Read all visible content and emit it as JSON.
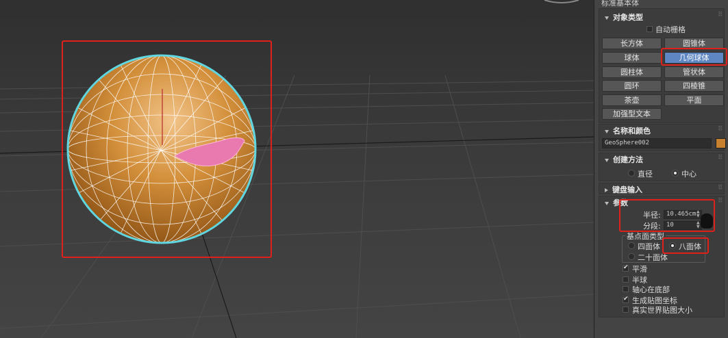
{
  "panel": {
    "top_label": "标准基本体",
    "object_type": {
      "header": "对象类型",
      "auto_grid": "自动栅格",
      "auto_grid_checked": false,
      "buttons": [
        "长方体",
        "圆锥体",
        "球体",
        "几何球体",
        "圆柱体",
        "管状体",
        "圆环",
        "四棱锥",
        "茶壶",
        "平面",
        "加强型文本"
      ],
      "selected": "几何球体"
    },
    "name_color": {
      "header": "名称和颜色",
      "name": "GeoSphere002",
      "color": "#c8812f"
    },
    "creation_method": {
      "header": "创建方法",
      "options": [
        "直径",
        "中心"
      ],
      "selected": "中心"
    },
    "keyboard_entry": {
      "header": "键盘输入"
    },
    "parameters": {
      "header": "参数",
      "radius_label": "半径:",
      "radius_value": "10.465cm",
      "segments_label": "分段:",
      "segments_value": "10",
      "base_type_label": "基点面类型",
      "base_types": [
        "四面体",
        "八面体",
        "二十面体"
      ],
      "base_type_selected": "八面体",
      "checkboxes": [
        {
          "label": "平滑",
          "checked": true
        },
        {
          "label": "半球",
          "checked": false
        },
        {
          "label": "轴心在底部",
          "checked": false
        },
        {
          "label": "生成贴图坐标",
          "checked": true
        },
        {
          "label": "真实世界贴图大小",
          "checked": false
        }
      ]
    }
  },
  "colors": {
    "highlight_red": "#e0201a",
    "sphere_orange": "#c8812f",
    "select_cyan": "#5fd6e0",
    "selected_button": "#5d86c2"
  }
}
